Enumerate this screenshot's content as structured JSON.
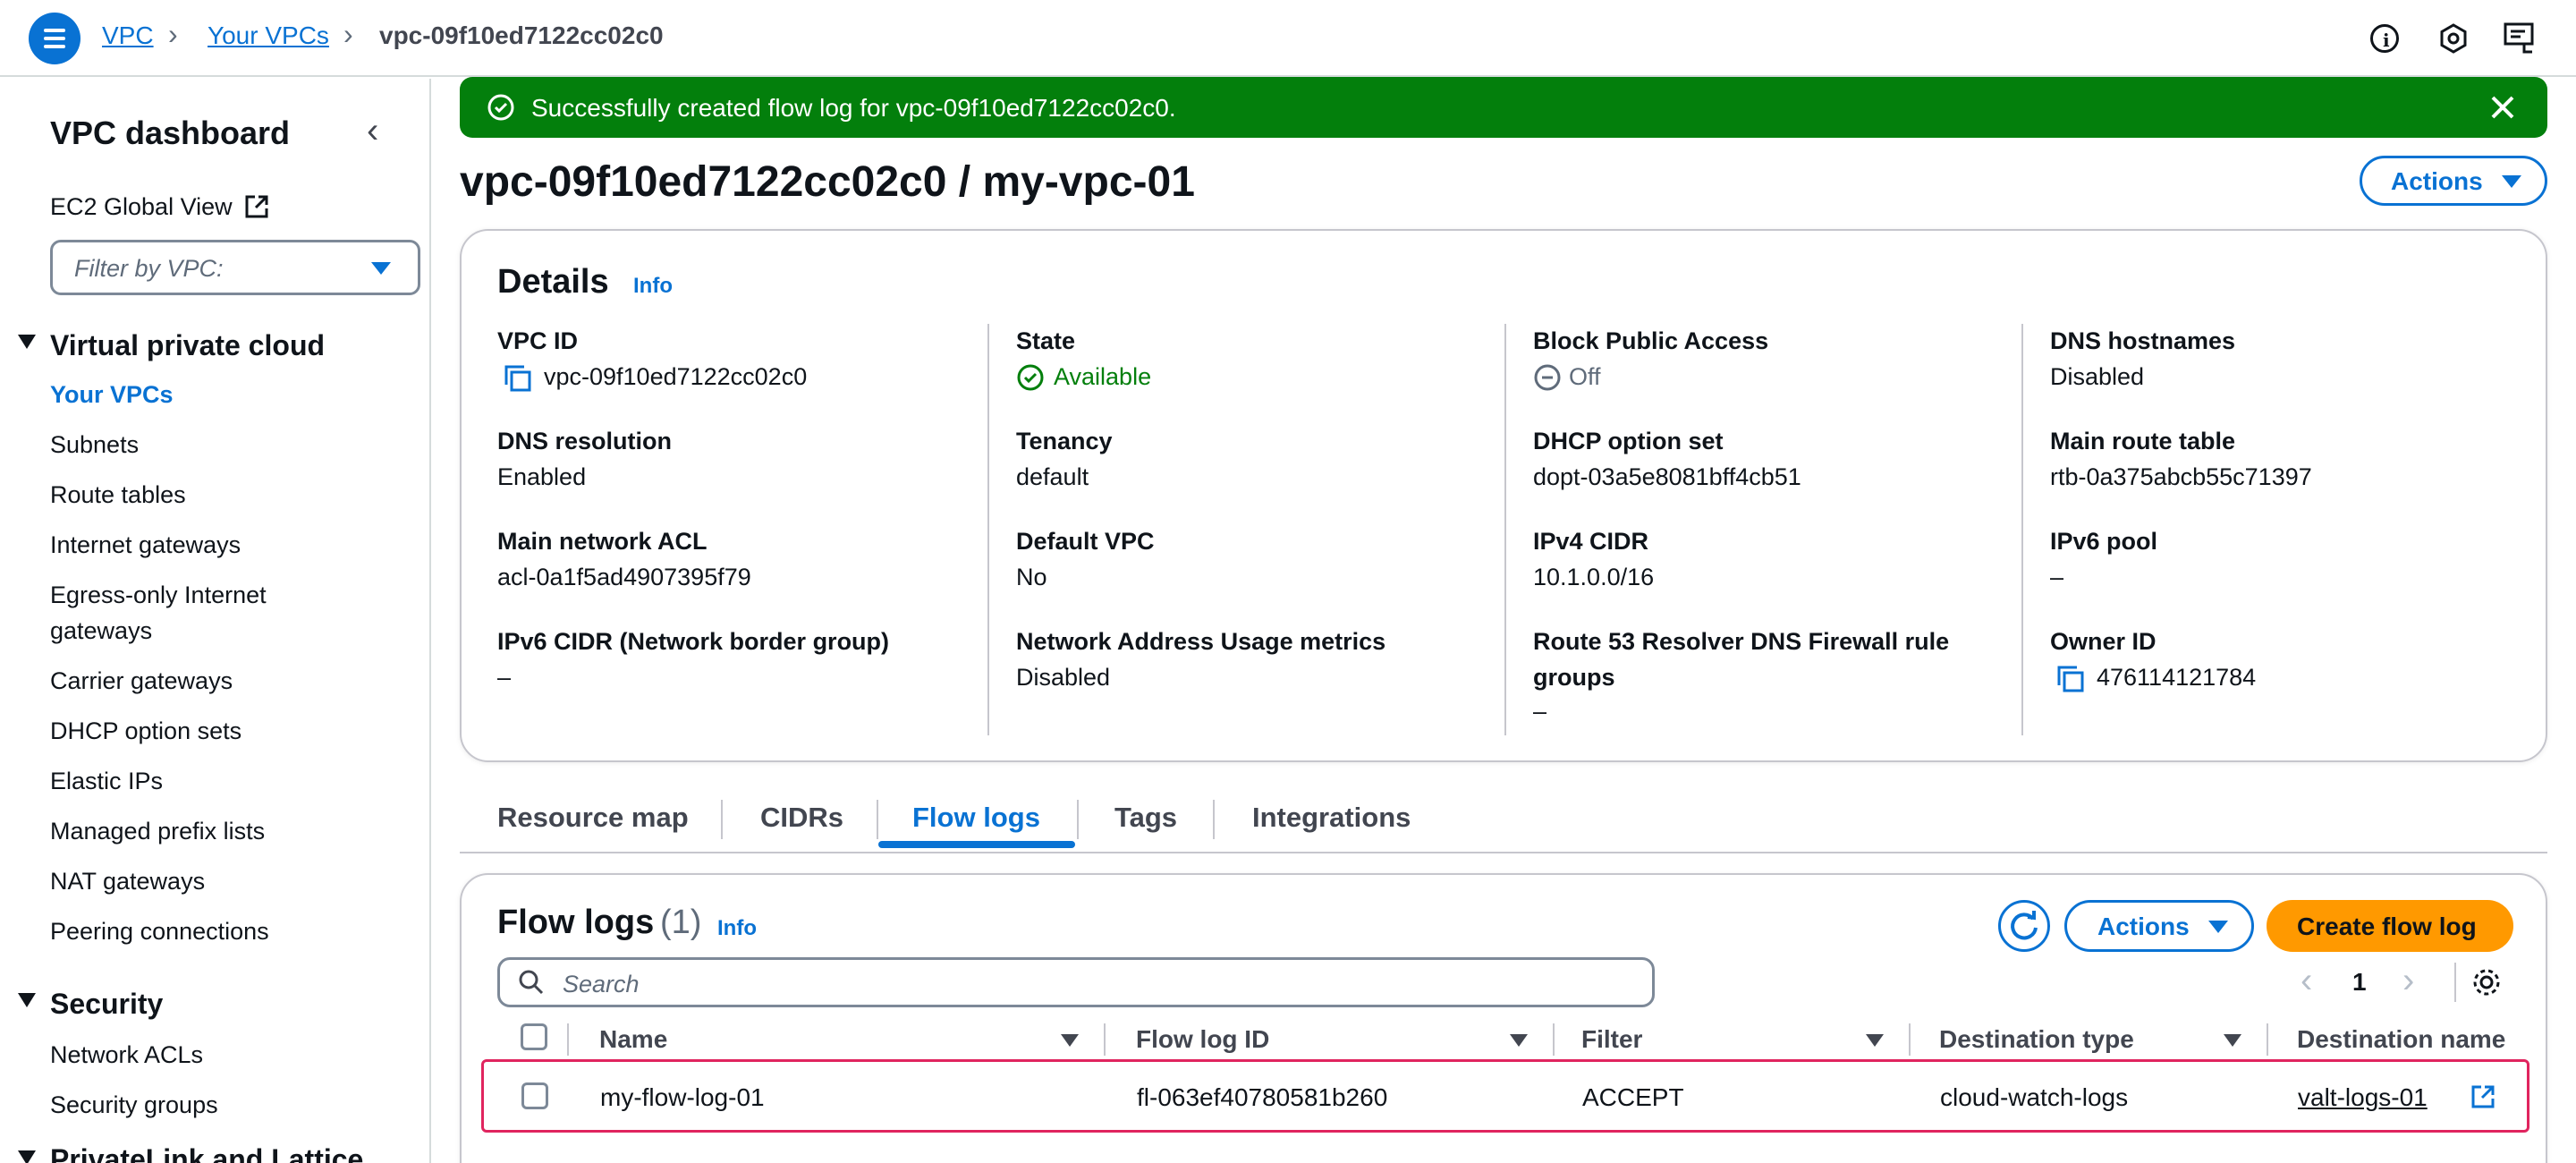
{
  "breadcrumbs": [
    {
      "label": "VPC"
    },
    {
      "label": "Your VPCs"
    },
    {
      "label": "vpc-09f10ed7122cc02c0"
    }
  ],
  "sidebar": {
    "title": "VPC dashboard",
    "ec2_global_view": "EC2 Global View",
    "filter_placeholder": "Filter by VPC:",
    "sections": [
      {
        "title": "Virtual private cloud",
        "items": [
          "Your VPCs",
          "Subnets",
          "Route tables",
          "Internet gateways",
          "Egress-only Internet",
          "gateways",
          "Carrier gateways",
          "DHCP option sets",
          "Elastic IPs",
          "Managed prefix lists",
          "NAT gateways",
          "Peering connections"
        ]
      },
      {
        "title": "Security",
        "items": [
          "Network ACLs",
          "Security groups"
        ]
      },
      {
        "title": "PrivateLink and Lattice"
      }
    ]
  },
  "flash": {
    "message": "Successfully created flow log for vpc-09f10ed7122cc02c0.",
    "color": "#037f0c"
  },
  "page": {
    "title": "vpc-09f10ed7122cc02c0 / my-vpc-01",
    "actions_label": "Actions"
  },
  "details": {
    "heading": "Details",
    "info": "Info",
    "columns": [
      [
        {
          "label": "VPC ID",
          "value": "vpc-09f10ed7122cc02c0"
        },
        {
          "label": "DNS resolution",
          "value": "Enabled"
        },
        {
          "label": "Main network ACL",
          "value": "acl-0a1f5ad4907395f79"
        },
        {
          "label": "IPv6 CIDR (Network border group)",
          "value": "–"
        }
      ],
      [
        {
          "label": "State",
          "value": "Available"
        },
        {
          "label": "Tenancy",
          "value": "default"
        },
        {
          "label": "Default VPC",
          "value": "No"
        },
        {
          "label": "Network Address Usage metrics",
          "value": "Disabled"
        }
      ],
      [
        {
          "label": "Block Public Access",
          "value": "Off"
        },
        {
          "label": "DHCP option set",
          "value": "dopt-03a5e8081bff4cb51"
        },
        {
          "label": "IPv4 CIDR",
          "value": "10.1.0.0/16"
        },
        {
          "label": "Route 53 Resolver DNS Firewall rule",
          "label2": "groups",
          "value": "–"
        }
      ],
      [
        {
          "label": "DNS hostnames",
          "value": "Disabled"
        },
        {
          "label": "Main route table",
          "value": "rtb-0a375abcb55c71397"
        },
        {
          "label": "IPv6 pool",
          "value": "–"
        },
        {
          "label": "Owner ID",
          "value": "476114121784"
        }
      ]
    ]
  },
  "tabs": [
    "Resource map",
    "CIDRs",
    "Flow logs",
    "Tags",
    "Integrations"
  ],
  "flow_logs": {
    "heading": "Flow logs",
    "count": "(1)",
    "info": "Info",
    "actions_label": "Actions",
    "create_label": "Create flow log",
    "search_placeholder": "Search",
    "page_number": "1",
    "columns": [
      "Name",
      "Flow log ID",
      "Filter",
      "Destination type",
      "Destination name"
    ],
    "rows": [
      {
        "name": "my-flow-log-01",
        "id": "fl-063ef40780581b260",
        "filter": "ACCEPT",
        "dest_type": "cloud-watch-logs",
        "dest_name": "valt-logs-01"
      }
    ]
  }
}
